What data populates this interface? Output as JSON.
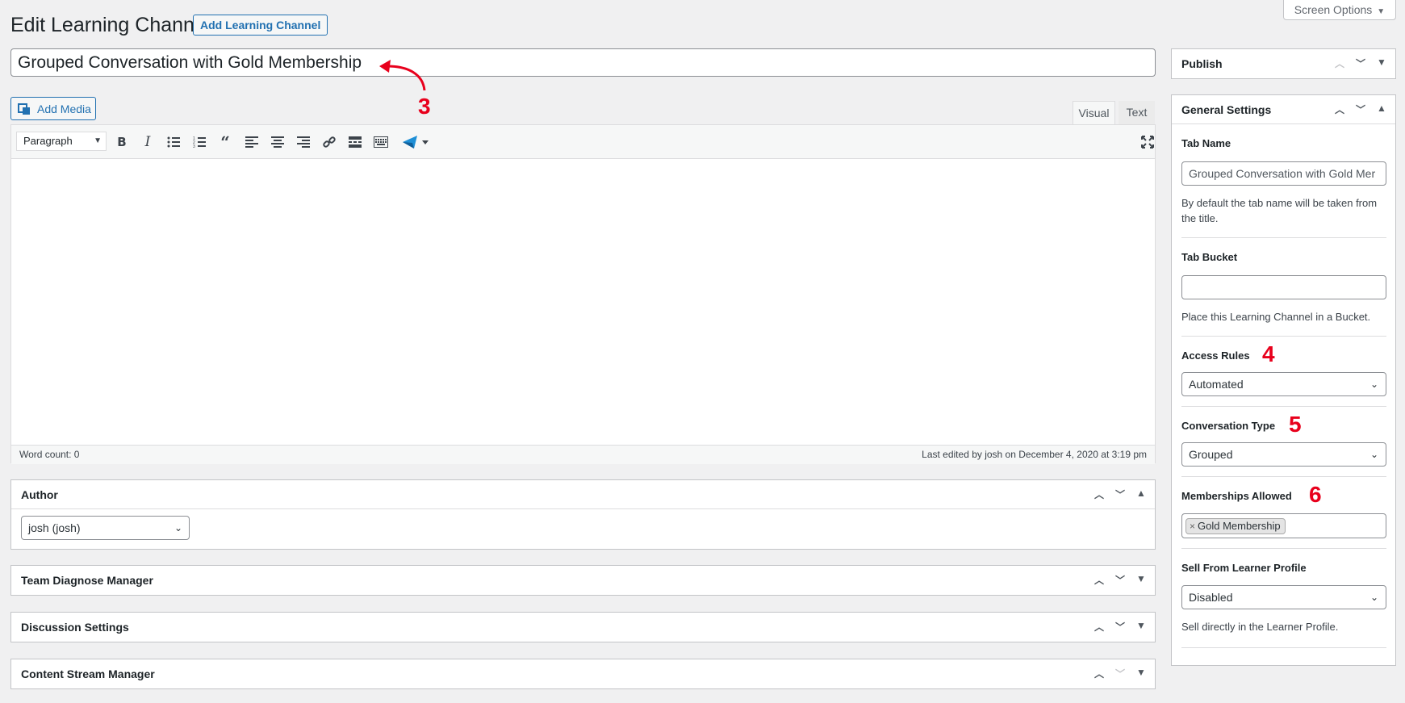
{
  "header": {
    "title": "Edit Learning Channel",
    "add_new_label": "Add Learning Channel",
    "screen_options_label": "Screen Options"
  },
  "post": {
    "title_value": "Grouped Conversation with Gold Membership"
  },
  "annotations": {
    "a3": "3",
    "a4": "4",
    "a5": "5",
    "a6": "6"
  },
  "editor": {
    "add_media_label": "Add Media",
    "tab_visual": "Visual",
    "tab_text": "Text",
    "format_select": "Paragraph",
    "toolbar_icons": [
      "bold-icon",
      "italic-icon",
      "bulleted-list-icon",
      "numbered-list-icon",
      "blockquote-icon",
      "align-left-icon",
      "align-center-icon",
      "align-right-icon",
      "link-icon",
      "read-more-icon",
      "toolbar-toggle-icon",
      "custom-plugin-icon",
      "fullscreen-icon"
    ],
    "word_count": "Word count: 0",
    "last_edited": "Last edited by josh on December 4, 2020 at 3:19 pm"
  },
  "metaboxes": {
    "author": {
      "title": "Author",
      "value": "josh (josh)"
    },
    "team_diagnose": {
      "title": "Team Diagnose Manager"
    },
    "discussion": {
      "title": "Discussion Settings"
    },
    "content_stream": {
      "title": "Content Stream Manager"
    }
  },
  "sidebar": {
    "publish_title": "Publish",
    "general_title": "General Settings",
    "tab_name_label": "Tab Name",
    "tab_name_value": "Grouped Conversation with Gold Mer",
    "tab_name_help": "By default the tab name will be taken from the title.",
    "tab_bucket_label": "Tab Bucket",
    "tab_bucket_value": "",
    "tab_bucket_help": "Place this Learning Channel in a Bucket.",
    "access_rules_label": "Access Rules",
    "access_rules_value": "Automated",
    "conversation_type_label": "Conversation Type",
    "conversation_type_value": "Grouped",
    "memberships_label": "Memberships Allowed",
    "memberships_tags": [
      "Gold Membership"
    ],
    "sell_label": "Sell From Learner Profile",
    "sell_value": "Disabled",
    "sell_help": "Sell directly in the Learner Profile."
  },
  "colors": {
    "accent": "#2271b1",
    "annotation": "#e8001c",
    "background": "#f0f0f1"
  }
}
